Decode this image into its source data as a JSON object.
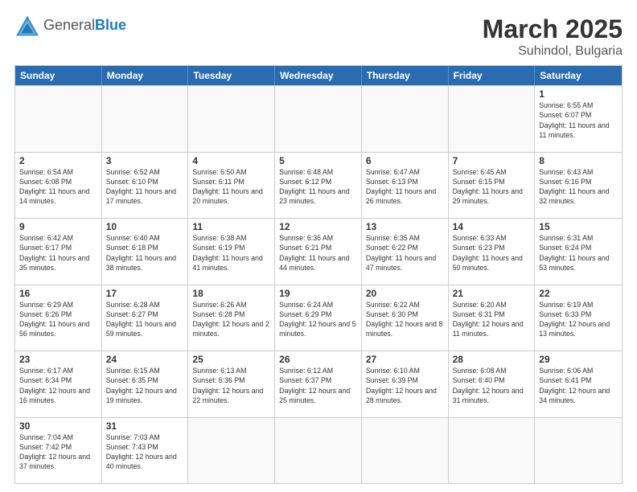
{
  "header": {
    "logo_general": "General",
    "logo_blue": "Blue",
    "month_year": "March 2025",
    "location": "Suhindol, Bulgaria"
  },
  "days_of_week": [
    "Sunday",
    "Monday",
    "Tuesday",
    "Wednesday",
    "Thursday",
    "Friday",
    "Saturday"
  ],
  "weeks": [
    [
      {
        "day": "",
        "info": ""
      },
      {
        "day": "",
        "info": ""
      },
      {
        "day": "",
        "info": ""
      },
      {
        "day": "",
        "info": ""
      },
      {
        "day": "",
        "info": ""
      },
      {
        "day": "",
        "info": ""
      },
      {
        "day": "1",
        "info": "Sunrise: 6:55 AM\nSunset: 6:07 PM\nDaylight: 11 hours and 11 minutes."
      }
    ],
    [
      {
        "day": "2",
        "info": "Sunrise: 6:54 AM\nSunset: 6:08 PM\nDaylight: 11 hours and 14 minutes."
      },
      {
        "day": "3",
        "info": "Sunrise: 6:52 AM\nSunset: 6:10 PM\nDaylight: 11 hours and 17 minutes."
      },
      {
        "day": "4",
        "info": "Sunrise: 6:50 AM\nSunset: 6:11 PM\nDaylight: 11 hours and 20 minutes."
      },
      {
        "day": "5",
        "info": "Sunrise: 6:48 AM\nSunset: 6:12 PM\nDaylight: 11 hours and 23 minutes."
      },
      {
        "day": "6",
        "info": "Sunrise: 6:47 AM\nSunset: 6:13 PM\nDaylight: 11 hours and 26 minutes."
      },
      {
        "day": "7",
        "info": "Sunrise: 6:45 AM\nSunset: 6:15 PM\nDaylight: 11 hours and 29 minutes."
      },
      {
        "day": "8",
        "info": "Sunrise: 6:43 AM\nSunset: 6:16 PM\nDaylight: 11 hours and 32 minutes."
      }
    ],
    [
      {
        "day": "9",
        "info": "Sunrise: 6:42 AM\nSunset: 6:17 PM\nDaylight: 11 hours and 35 minutes."
      },
      {
        "day": "10",
        "info": "Sunrise: 6:40 AM\nSunset: 6:18 PM\nDaylight: 11 hours and 38 minutes."
      },
      {
        "day": "11",
        "info": "Sunrise: 6:38 AM\nSunset: 6:19 PM\nDaylight: 11 hours and 41 minutes."
      },
      {
        "day": "12",
        "info": "Sunrise: 6:36 AM\nSunset: 6:21 PM\nDaylight: 11 hours and 44 minutes."
      },
      {
        "day": "13",
        "info": "Sunrise: 6:35 AM\nSunset: 6:22 PM\nDaylight: 11 hours and 47 minutes."
      },
      {
        "day": "14",
        "info": "Sunrise: 6:33 AM\nSunset: 6:23 PM\nDaylight: 11 hours and 50 minutes."
      },
      {
        "day": "15",
        "info": "Sunrise: 6:31 AM\nSunset: 6:24 PM\nDaylight: 11 hours and 53 minutes."
      }
    ],
    [
      {
        "day": "16",
        "info": "Sunrise: 6:29 AM\nSunset: 6:26 PM\nDaylight: 11 hours and 56 minutes."
      },
      {
        "day": "17",
        "info": "Sunrise: 6:28 AM\nSunset: 6:27 PM\nDaylight: 11 hours and 59 minutes."
      },
      {
        "day": "18",
        "info": "Sunrise: 6:26 AM\nSunset: 6:28 PM\nDaylight: 12 hours and 2 minutes."
      },
      {
        "day": "19",
        "info": "Sunrise: 6:24 AM\nSunset: 6:29 PM\nDaylight: 12 hours and 5 minutes."
      },
      {
        "day": "20",
        "info": "Sunrise: 6:22 AM\nSunset: 6:30 PM\nDaylight: 12 hours and 8 minutes."
      },
      {
        "day": "21",
        "info": "Sunrise: 6:20 AM\nSunset: 6:31 PM\nDaylight: 12 hours and 11 minutes."
      },
      {
        "day": "22",
        "info": "Sunrise: 6:19 AM\nSunset: 6:33 PM\nDaylight: 12 hours and 13 minutes."
      }
    ],
    [
      {
        "day": "23",
        "info": "Sunrise: 6:17 AM\nSunset: 6:34 PM\nDaylight: 12 hours and 16 minutes."
      },
      {
        "day": "24",
        "info": "Sunrise: 6:15 AM\nSunset: 6:35 PM\nDaylight: 12 hours and 19 minutes."
      },
      {
        "day": "25",
        "info": "Sunrise: 6:13 AM\nSunset: 6:36 PM\nDaylight: 12 hours and 22 minutes."
      },
      {
        "day": "26",
        "info": "Sunrise: 6:12 AM\nSunset: 6:37 PM\nDaylight: 12 hours and 25 minutes."
      },
      {
        "day": "27",
        "info": "Sunrise: 6:10 AM\nSunset: 6:39 PM\nDaylight: 12 hours and 28 minutes."
      },
      {
        "day": "28",
        "info": "Sunrise: 6:08 AM\nSunset: 6:40 PM\nDaylight: 12 hours and 31 minutes."
      },
      {
        "day": "29",
        "info": "Sunrise: 6:06 AM\nSunset: 6:41 PM\nDaylight: 12 hours and 34 minutes."
      }
    ],
    [
      {
        "day": "30",
        "info": "Sunrise: 7:04 AM\nSunset: 7:42 PM\nDaylight: 12 hours and 37 minutes."
      },
      {
        "day": "31",
        "info": "Sunrise: 7:03 AM\nSunset: 7:43 PM\nDaylight: 12 hours and 40 minutes."
      },
      {
        "day": "",
        "info": ""
      },
      {
        "day": "",
        "info": ""
      },
      {
        "day": "",
        "info": ""
      },
      {
        "day": "",
        "info": ""
      },
      {
        "day": "",
        "info": ""
      }
    ]
  ]
}
